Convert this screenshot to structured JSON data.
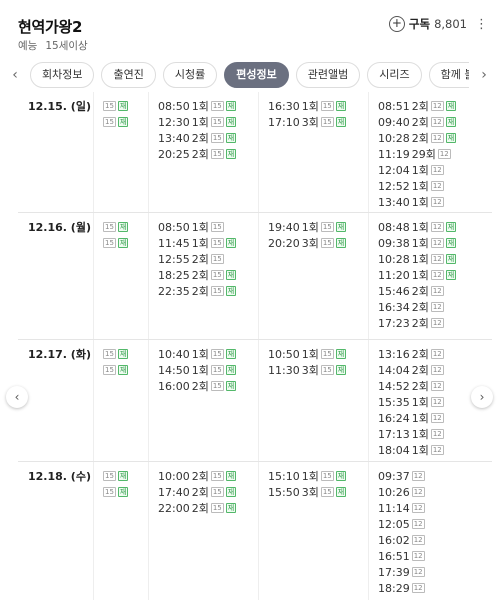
{
  "header": {
    "title": "현역가왕2",
    "genre": "예능",
    "rating": "15세이상",
    "subscribe_label": "구독",
    "subscribe_count": "8,801",
    "plus_glyph": "+",
    "more_glyph": "⋮"
  },
  "tabs": {
    "prev_glyph": "‹",
    "next_glyph": "›",
    "items": [
      {
        "label": "회차정보",
        "active": false
      },
      {
        "label": "출연진",
        "active": false
      },
      {
        "label": "시청률",
        "active": false
      },
      {
        "label": "편성정보",
        "active": true
      },
      {
        "label": "관련앨범",
        "active": false
      },
      {
        "label": "시리즈",
        "active": false
      },
      {
        "label": "함께 볼만한",
        "active": false
      }
    ]
  },
  "nav": {
    "prev_glyph": "‹",
    "next_glyph": "›"
  },
  "colors": {
    "rebroadcast": "#2e9b48",
    "active_tab": "#6b7080"
  },
  "schedule": [
    {
      "date": "12.15. (일)",
      "c2": [
        {
          "badges": [
            "15",
            "재"
          ]
        },
        {
          "badges": [
            "15",
            "재"
          ]
        }
      ],
      "c3": [
        {
          "time": "08:50",
          "ep": "1회",
          "badges": [
            "15",
            "재"
          ]
        },
        {
          "time": "12:30",
          "ep": "1회",
          "badges": [
            "15",
            "재"
          ]
        },
        {
          "time": "13:40",
          "ep": "2회",
          "badges": [
            "15",
            "재"
          ]
        },
        {
          "time": "20:25",
          "ep": "2회",
          "badges": [
            "15",
            "재"
          ]
        }
      ],
      "c4": [
        {
          "time": "16:30",
          "ep": "1회",
          "badges": [
            "15",
            "재"
          ]
        },
        {
          "time": "17:10",
          "ep": "3회",
          "badges": [
            "15",
            "재"
          ]
        }
      ],
      "c5": [
        {
          "time": "08:51",
          "ep": "2회",
          "badges": [
            "12",
            "재"
          ]
        },
        {
          "time": "09:40",
          "ep": "2회",
          "badges": [
            "12",
            "재"
          ]
        },
        {
          "time": "10:28",
          "ep": "2회",
          "badges": [
            "12",
            "재"
          ]
        },
        {
          "time": "11:19",
          "ep": "29회",
          "badges": [
            "12"
          ]
        },
        {
          "time": "12:04",
          "ep": "1회",
          "badges": [
            "12"
          ]
        },
        {
          "time": "12:52",
          "ep": "1회",
          "badges": [
            "12"
          ]
        },
        {
          "time": "13:40",
          "ep": "1회",
          "badges": [
            "12"
          ]
        }
      ]
    },
    {
      "date": "12.16. (월)",
      "c2": [
        {
          "badges": [
            "15",
            "재"
          ]
        },
        {
          "badges": [
            "15",
            "재"
          ]
        }
      ],
      "c3": [
        {
          "time": "08:50",
          "ep": "1회",
          "badges": [
            "15"
          ]
        },
        {
          "time": "11:45",
          "ep": "1회",
          "badges": [
            "15",
            "재"
          ]
        },
        {
          "time": "12:55",
          "ep": "2회",
          "badges": [
            "15"
          ]
        },
        {
          "time": "18:25",
          "ep": "2회",
          "badges": [
            "15",
            "재"
          ]
        },
        {
          "time": "22:35",
          "ep": "2회",
          "badges": [
            "15",
            "재"
          ]
        }
      ],
      "c4": [
        {
          "time": "19:40",
          "ep": "1회",
          "badges": [
            "15",
            "재"
          ]
        },
        {
          "time": "20:20",
          "ep": "3회",
          "badges": [
            "15",
            "재"
          ]
        }
      ],
      "c5": [
        {
          "time": "08:48",
          "ep": "1회",
          "badges": [
            "12",
            "재"
          ]
        },
        {
          "time": "09:38",
          "ep": "1회",
          "badges": [
            "12",
            "재"
          ]
        },
        {
          "time": "10:28",
          "ep": "1회",
          "badges": [
            "12",
            "재"
          ]
        },
        {
          "time": "11:20",
          "ep": "1회",
          "badges": [
            "12",
            "재"
          ]
        },
        {
          "time": "15:46",
          "ep": "2회",
          "badges": [
            "12"
          ]
        },
        {
          "time": "16:34",
          "ep": "2회",
          "badges": [
            "12"
          ]
        },
        {
          "time": "17:23",
          "ep": "2회",
          "badges": [
            "12"
          ]
        }
      ]
    },
    {
      "date": "12.17. (화)",
      "c2": [
        {
          "badges": [
            "15",
            "재"
          ]
        },
        {
          "badges": [
            "15",
            "재"
          ]
        }
      ],
      "c3": [
        {
          "time": "10:40",
          "ep": "1회",
          "badges": [
            "15",
            "재"
          ]
        },
        {
          "time": "14:50",
          "ep": "1회",
          "badges": [
            "15",
            "재"
          ]
        },
        {
          "time": "16:00",
          "ep": "2회",
          "badges": [
            "15",
            "재"
          ]
        }
      ],
      "c4": [
        {
          "time": "10:50",
          "ep": "1회",
          "badges": [
            "15",
            "재"
          ]
        },
        {
          "time": "11:30",
          "ep": "3회",
          "badges": [
            "15",
            "재"
          ]
        }
      ],
      "c5": [
        {
          "time": "13:16",
          "ep": "2회",
          "badges": [
            "12"
          ]
        },
        {
          "time": "14:04",
          "ep": "2회",
          "badges": [
            "12"
          ]
        },
        {
          "time": "14:52",
          "ep": "2회",
          "badges": [
            "12"
          ]
        },
        {
          "time": "15:35",
          "ep": "1회",
          "badges": [
            "12"
          ]
        },
        {
          "time": "16:24",
          "ep": "1회",
          "badges": [
            "12"
          ]
        },
        {
          "time": "17:13",
          "ep": "1회",
          "badges": [
            "12"
          ]
        },
        {
          "time": "18:04",
          "ep": "1회",
          "badges": [
            "12"
          ]
        }
      ]
    },
    {
      "date": "12.18. (수)",
      "c2": [
        {
          "badges": [
            "15",
            "재"
          ]
        },
        {
          "badges": [
            "15",
            "재"
          ]
        }
      ],
      "c3": [
        {
          "time": "10:00",
          "ep": "2회",
          "badges": [
            "15",
            "재"
          ]
        },
        {
          "time": "17:40",
          "ep": "2회",
          "badges": [
            "15",
            "재"
          ]
        },
        {
          "time": "22:00",
          "ep": "2회",
          "badges": [
            "15",
            "재"
          ]
        }
      ],
      "c4": [
        {
          "time": "15:10",
          "ep": "1회",
          "badges": [
            "15",
            "재"
          ]
        },
        {
          "time": "15:50",
          "ep": "3회",
          "badges": [
            "15",
            "재"
          ]
        }
      ],
      "c5": [
        {
          "time": "09:37",
          "ep": "",
          "badges": [
            "12"
          ]
        },
        {
          "time": "10:26",
          "ep": "",
          "badges": [
            "12"
          ]
        },
        {
          "time": "11:14",
          "ep": "",
          "badges": [
            "12"
          ]
        },
        {
          "time": "12:05",
          "ep": "",
          "badges": [
            "12"
          ]
        },
        {
          "time": "16:02",
          "ep": "",
          "badges": [
            "12"
          ]
        },
        {
          "time": "16:51",
          "ep": "",
          "badges": [
            "12"
          ]
        },
        {
          "time": "17:39",
          "ep": "",
          "badges": [
            "12"
          ]
        },
        {
          "time": "18:29",
          "ep": "",
          "badges": [
            "12"
          ]
        }
      ]
    }
  ]
}
